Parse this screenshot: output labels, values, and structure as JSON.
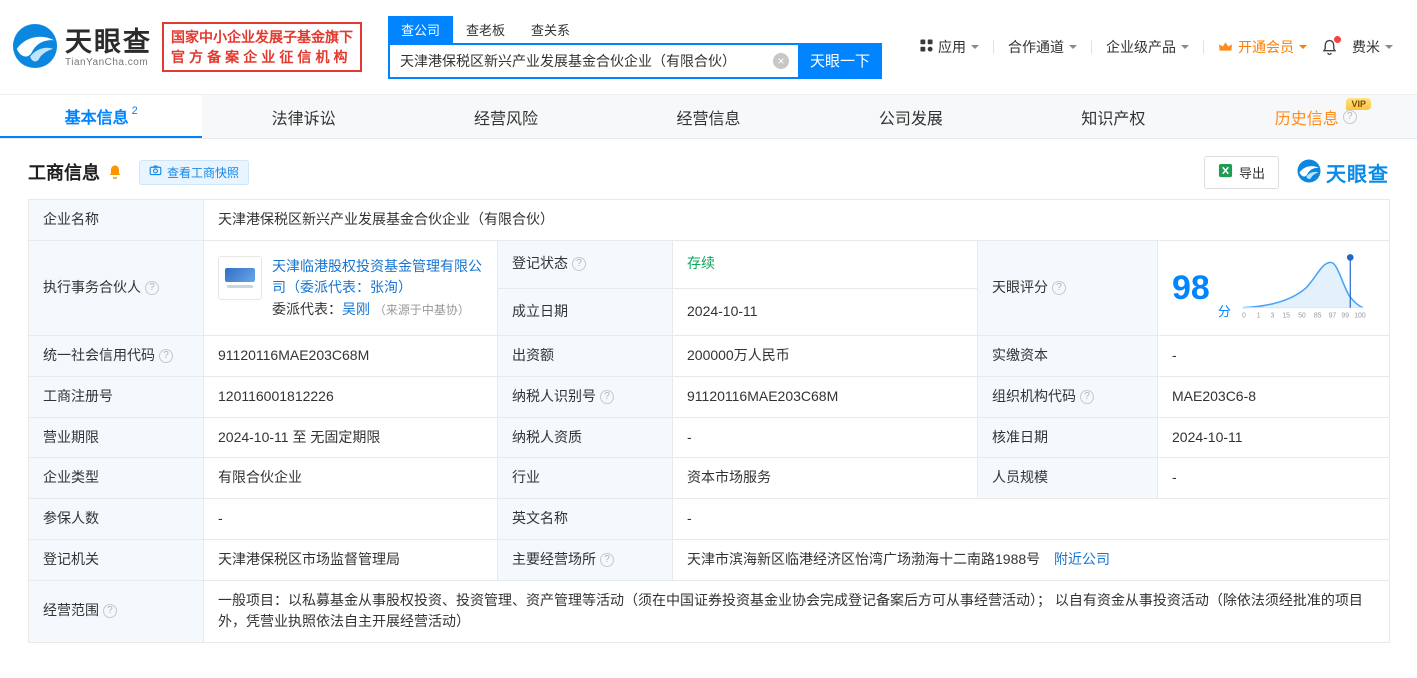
{
  "colors": {
    "accent": "#0084ff",
    "status_green": "#0aa85c",
    "vip_orange": "#ff8c1a",
    "badge_red": "#e23a2f"
  },
  "brand": {
    "name": "天眼查",
    "domain": "TianYanCha.com"
  },
  "badge": {
    "line1": "国家中小企业发展子基金旗下",
    "line2": "官方备案企业征信机构"
  },
  "search": {
    "tabs": [
      "查公司",
      "查老板",
      "查关系"
    ],
    "value": "天津港保税区新兴产业发展基金合伙企业（有限合伙）",
    "button": "天眼一下"
  },
  "topnav": {
    "apps": "应用",
    "partner": "合作通道",
    "enterprise": "企业级产品",
    "vip": "开通会员",
    "user": "费米"
  },
  "tabs": [
    {
      "label": "基本信息",
      "count": "2"
    },
    {
      "label": "法律诉讼"
    },
    {
      "label": "经营风险"
    },
    {
      "label": "经营信息"
    },
    {
      "label": "公司发展"
    },
    {
      "label": "知识产权"
    },
    {
      "label": "历史信息",
      "vip": "VIP"
    }
  ],
  "section": {
    "title": "工商信息",
    "snapshot": "查看工商快照",
    "export": "导出",
    "watermark": "天眼查"
  },
  "info": {
    "name_label": "企业名称",
    "name_value": "天津港保税区新兴产业发展基金合伙企业（有限合伙）",
    "partner_label": "执行事务合伙人",
    "partner_link": "天津临港股权投资基金管理有限公司（委派代表：张洵）",
    "rep_label": "委派代表：",
    "rep_name": "吴刚",
    "rep_source": "（来源于中基协）",
    "status_label": "登记状态",
    "status_value": "存续",
    "established_label": "成立日期",
    "established_value": "2024-10-11",
    "credit_code_label": "统一社会信用代码",
    "credit_code_value": "91120116MAE203C68M",
    "capital_label": "出资额",
    "capital_value": "200000万人民币",
    "paidin_label": "实缴资本",
    "paidin_value": "-",
    "regno_label": "工商注册号",
    "regno_value": "120116001812226",
    "taxid_label": "纳税人识别号",
    "taxid_value": "91120116MAE203C68M",
    "orgcode_label": "组织机构代码",
    "orgcode_value": "MAE203C6-8",
    "term_label": "营业期限",
    "term_value": "2024-10-11 至 无固定期限",
    "taxqual_label": "纳税人资质",
    "taxqual_value": "-",
    "approval_label": "核准日期",
    "approval_value": "2024-10-11",
    "type_label": "企业类型",
    "type_value": "有限合伙企业",
    "industry_label": "行业",
    "industry_value": "资本市场服务",
    "staff_label": "人员规模",
    "staff_value": "-",
    "insured_label": "参保人数",
    "insured_value": "-",
    "enname_label": "英文名称",
    "enname_value": "-",
    "authority_label": "登记机关",
    "authority_value": "天津港保税区市场监督管理局",
    "address_label": "主要经营场所",
    "address_value": "天津市滨海新区临港经济区怡湾广场渤海十二南路1988号",
    "nearby_label": "附近公司",
    "scope_label": "经营范围",
    "scope_value": "一般项目：以私募基金从事股权投资、投资管理、资产管理等活动（须在中国证券投资基金业协会完成登记备案后方可从事经营活动）； 以自有资金从事投资活动（除依法须经批准的项目外，凭营业执照依法自主开展经营活动）"
  },
  "score": {
    "label": "天眼评分",
    "value": "98",
    "unit": "分",
    "axis": [
      "0",
      "1",
      "3",
      "15",
      "50",
      "85",
      "97",
      "99",
      "100"
    ]
  }
}
